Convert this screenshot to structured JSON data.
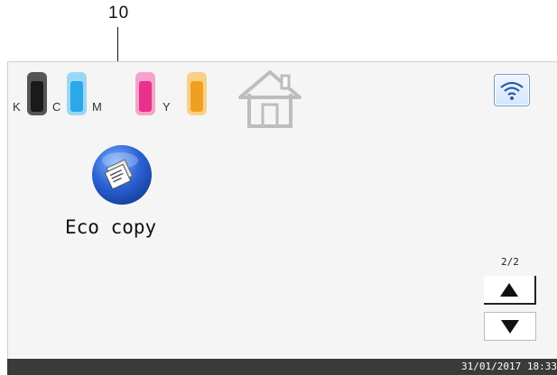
{
  "callout": {
    "number": "10"
  },
  "toners": [
    {
      "letter": "K",
      "color": "#2a2a2a"
    },
    {
      "letter": "C",
      "color": "#2aa8e8"
    },
    {
      "letter": "M",
      "color": "#e8308c"
    },
    {
      "letter": "Y",
      "color": "#f0a020"
    }
  ],
  "home_icon": "home-icon",
  "wifi_icon": "wifi-icon",
  "eco_copy": {
    "label": "Eco copy",
    "icon": "eco-copy-icon"
  },
  "pager": {
    "page": "2/2"
  },
  "status": {
    "datetime": "31/01/2017 18:33"
  }
}
